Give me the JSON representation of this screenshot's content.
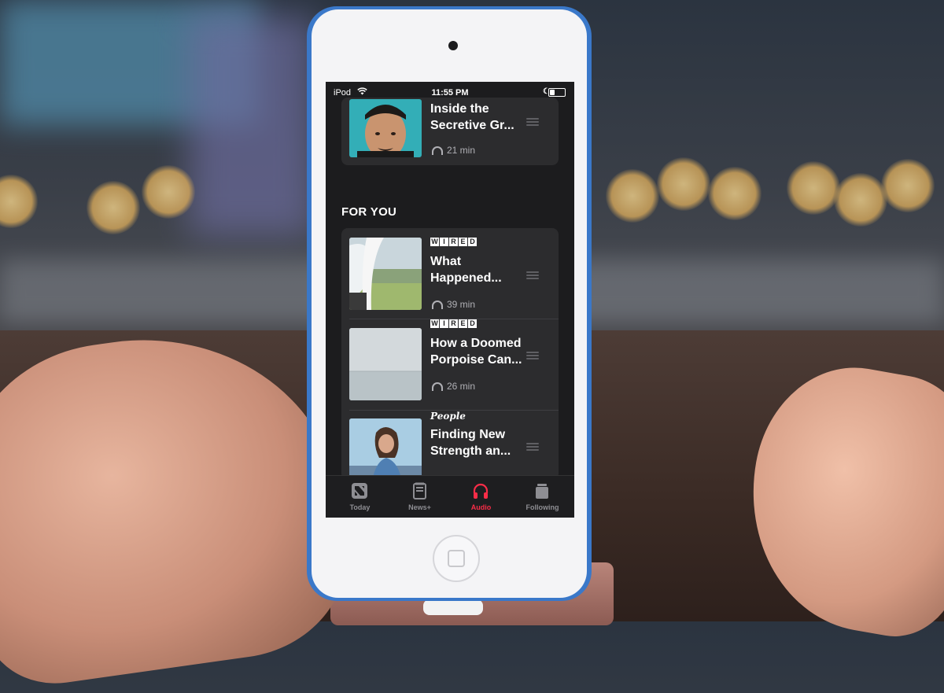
{
  "status_bar": {
    "carrier": "iPod",
    "time": "11:55 PM",
    "battery_level": 0.35
  },
  "top_item": {
    "title_line1": "Inside the",
    "title_line2": "Secretive Gr...",
    "duration": "21 min"
  },
  "section": {
    "title": "FOR YOU"
  },
  "items": [
    {
      "publisher": "WIRED",
      "title_line1": "What",
      "title_line2": "Happened...",
      "duration": "39 min"
    },
    {
      "publisher": "WIRED",
      "title_line1": "How a Doomed",
      "title_line2": "Porpoise Can...",
      "duration": "26 min"
    },
    {
      "publisher": "People",
      "title_line1": "Finding New",
      "title_line2": "Strength an...",
      "duration": ""
    }
  ],
  "tabs": [
    {
      "label": "Today",
      "icon": "news-logo-icon"
    },
    {
      "label": "News+",
      "icon": "news-plus-icon"
    },
    {
      "label": "Audio",
      "icon": "headphones-icon",
      "active": true
    },
    {
      "label": "Following",
      "icon": "following-icon"
    }
  ],
  "colors": {
    "accent": "#fa2d48",
    "background": "#1c1c1e",
    "card": "#2c2c2e"
  }
}
